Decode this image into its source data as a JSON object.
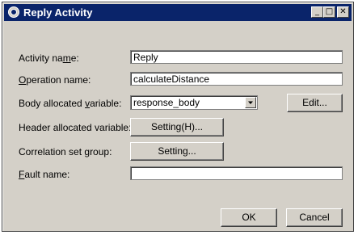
{
  "window": {
    "title": "Reply Activity",
    "controls": {
      "minimize": "_",
      "maximize": "□",
      "close": "✕"
    }
  },
  "fields": {
    "activity_name": {
      "label_pre": "Activity na",
      "label_key": "m",
      "label_post": "e:",
      "value": "Reply"
    },
    "operation_name": {
      "label_pre": "",
      "label_key": "O",
      "label_post": "peration name:",
      "value": "calculateDistance"
    },
    "body_variable": {
      "label_pre": "Body allocated ",
      "label_key": "v",
      "label_post": "ariable:",
      "value": "response_body",
      "edit_button": "Edit..."
    },
    "header_variable": {
      "label": "Header allocated variable:",
      "button": "Setting(H)..."
    },
    "correlation_set_group": {
      "label_pre": "Correlation set ",
      "label_key": "g",
      "label_post": "roup:",
      "button": "Setting..."
    },
    "fault_name": {
      "label_pre": "",
      "label_key": "F",
      "label_post": "ault name:",
      "value": ""
    }
  },
  "footer": {
    "ok": "OK",
    "cancel": "Cancel"
  },
  "colors": {
    "titlebar": "#0a246a",
    "face": "#d4d0c8"
  }
}
